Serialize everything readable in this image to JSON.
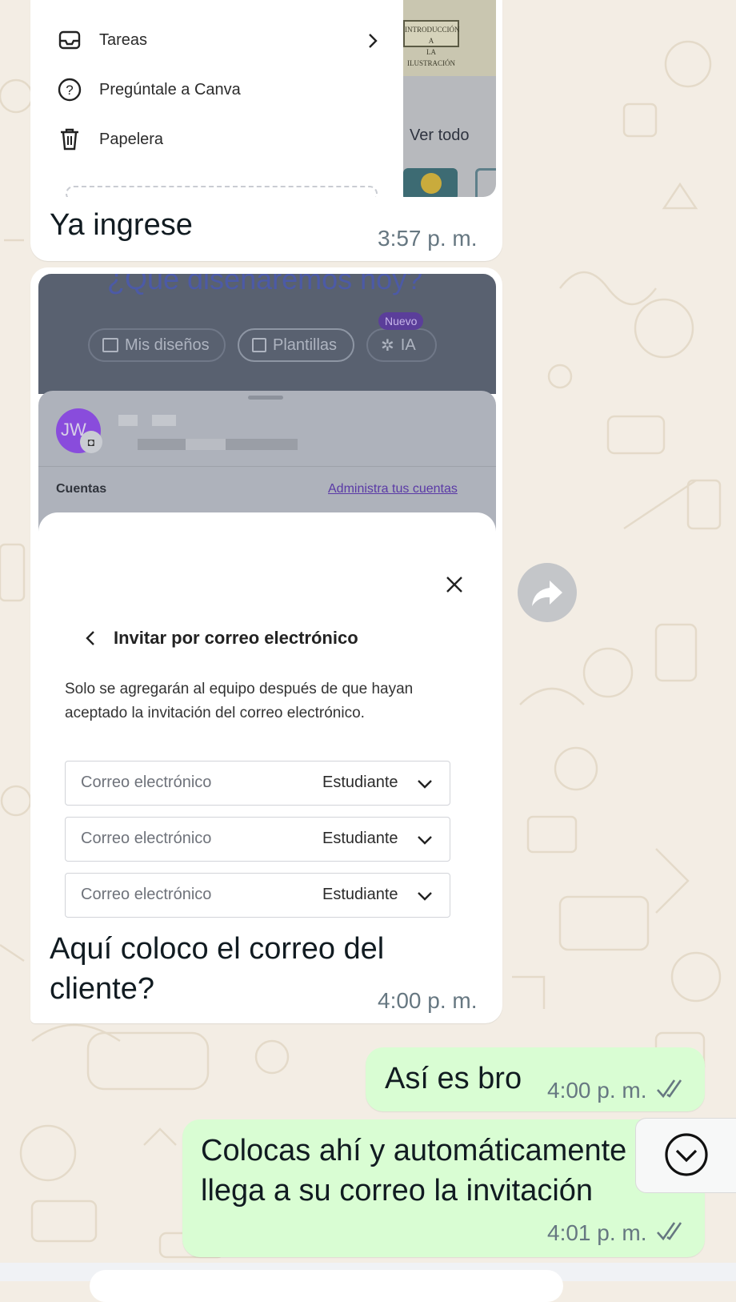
{
  "messages": [
    {
      "direction": "incoming",
      "caption": "Ya ingrese",
      "time": "3:57 p. m.",
      "screenshot": {
        "menu": [
          {
            "label": "Tareas",
            "icon": "inbox-icon",
            "has_chevron": true
          },
          {
            "label": "Pregúntale a Canva",
            "icon": "help-circle-icon"
          },
          {
            "label": "Papelera",
            "icon": "trash-icon"
          }
        ],
        "side_panel": {
          "thumbnail_text_1": "INTRODUCCIÓN A",
          "thumbnail_text_2": "LA ILUSTRACIÓN",
          "see_all": "Ver todo"
        }
      }
    },
    {
      "direction": "incoming",
      "caption_line1": "Aquí coloco el correo del",
      "caption_line2": "cliente?",
      "time": "4:00 p. m.",
      "screenshot": {
        "headline": "¿Qué diseñaremos hoy?",
        "pills": [
          "Mis diseños",
          "Plantillas",
          "IA"
        ],
        "new_badge": "Nuevo",
        "avatar_initials": "JW",
        "accounts_label": "Cuentas",
        "manage_accounts_link": "Administra tus cuentas",
        "dialog": {
          "title": "Invitar por correo electrónico",
          "description_line1": "Solo se agregarán al equipo después de que hayan",
          "description_line2": "aceptado la invitación del correo electrónico.",
          "rows": [
            {
              "placeholder": "Correo electrónico",
              "role": "Estudiante"
            },
            {
              "placeholder": "Correo electrónico",
              "role": "Estudiante"
            },
            {
              "placeholder": "Correo electrónico",
              "role": "Estudiante"
            }
          ]
        }
      }
    },
    {
      "direction": "outgoing",
      "text": "Así es bro",
      "time": "4:00 p. m.",
      "status": "read"
    },
    {
      "direction": "outgoing",
      "text_line1": "Colocas ahí y automáticamente",
      "text_line2": "llega a su correo la invitación",
      "time": "4:01 p. m.",
      "status": "read"
    }
  ],
  "colors": {
    "outgoing_bubble": "#d9fdd3",
    "incoming_bubble": "#ffffff",
    "wallpaper": "#f3ede4",
    "canva_purple": "#7d2ae8",
    "read_tick": "#667781"
  },
  "icons": {
    "share": "forward-arrow-icon",
    "scroll": "chevron-down-circle-icon",
    "close": "close-icon",
    "back": "chevron-left-icon"
  }
}
